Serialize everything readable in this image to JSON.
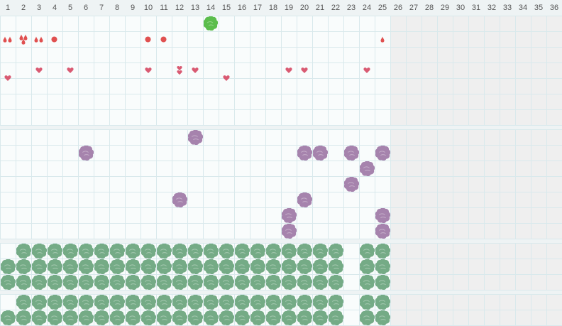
{
  "header": {
    "columns": [
      "1",
      "2",
      "3",
      "4",
      "5",
      "6",
      "7",
      "8",
      "9",
      "10",
      "11",
      "12",
      "13",
      "14",
      "15",
      "16",
      "17",
      "18",
      "19",
      "20",
      "21",
      "22",
      "23",
      "24",
      "25",
      "26",
      "27",
      "28",
      "29",
      "30",
      "31",
      "32",
      "33",
      "34",
      "35",
      "36"
    ]
  },
  "settings": {
    "total_columns": 36,
    "active_columns": 25
  },
  "colors": {
    "grid_line": "#d9e9ec",
    "active_bg": "#f9fcfc",
    "inactive_bg": "#efefef",
    "section_gap": "#e8f0f1",
    "heart": "#d95a72",
    "dot": "#e05050",
    "drop": "#e05050",
    "purple_flower": "#a683ad",
    "green_flower": "#75ab86",
    "bright_green_flower": "#5bbd4c"
  },
  "sections": [
    {
      "name": "symbols",
      "rows": 7,
      "items": [
        {
          "type": "green-flower",
          "row": 0,
          "col": 14
        },
        {
          "type": "drops-pair",
          "row": 1,
          "col": 1
        },
        {
          "type": "drops-cluster",
          "row": 1,
          "col": 2
        },
        {
          "type": "drops-pair",
          "row": 1,
          "col": 3
        },
        {
          "type": "dot",
          "row": 1,
          "col": 4
        },
        {
          "type": "dot",
          "row": 1,
          "col": 10
        },
        {
          "type": "dot",
          "row": 1,
          "col": 11
        },
        {
          "type": "drop",
          "row": 1,
          "col": 25
        },
        {
          "type": "heart",
          "row": 3,
          "col": 1,
          "offset": 0.5
        },
        {
          "type": "heart",
          "row": 3,
          "col": 3
        },
        {
          "type": "heart",
          "row": 3,
          "col": 5
        },
        {
          "type": "heart",
          "row": 3,
          "col": 10
        },
        {
          "type": "heart-pair",
          "row": 3,
          "col": 12
        },
        {
          "type": "heart",
          "row": 3,
          "col": 13
        },
        {
          "type": "heart",
          "row": 3,
          "col": 15,
          "offset": 0.5
        },
        {
          "type": "heart",
          "row": 3,
          "col": 19
        },
        {
          "type": "heart",
          "row": 3,
          "col": 20
        },
        {
          "type": "heart",
          "row": 3,
          "col": 24
        }
      ]
    },
    {
      "name": "purple",
      "rows": 7,
      "items": [
        {
          "type": "purple-flower",
          "row": 0,
          "col": 13
        },
        {
          "type": "purple-flower",
          "row": 1,
          "col": 6
        },
        {
          "type": "purple-flower",
          "row": 1,
          "col": 20
        },
        {
          "type": "purple-flower",
          "row": 1,
          "col": 21
        },
        {
          "type": "purple-flower",
          "row": 1,
          "col": 23
        },
        {
          "type": "purple-flower",
          "row": 1,
          "col": 25
        },
        {
          "type": "purple-flower",
          "row": 2,
          "col": 24
        },
        {
          "type": "purple-flower",
          "row": 3,
          "col": 23
        },
        {
          "type": "purple-flower",
          "row": 4,
          "col": 12
        },
        {
          "type": "purple-flower",
          "row": 4,
          "col": 20
        },
        {
          "type": "purple-flower",
          "row": 5,
          "col": 19
        },
        {
          "type": "purple-flower",
          "row": 5,
          "col": 25
        },
        {
          "type": "purple-flower",
          "row": 6,
          "col": 19
        },
        {
          "type": "purple-flower",
          "row": 6,
          "col": 25
        }
      ]
    },
    {
      "name": "green-a",
      "rows": 3,
      "fill": {
        "type": "green-flower-muted",
        "rows": [
          {
            "from": 2,
            "to": 22,
            "extra": [
              24,
              25
            ]
          },
          {
            "from": 1,
            "to": 22,
            "extra": [
              24,
              25
            ]
          },
          {
            "from": 1,
            "to": 22,
            "extra": [
              24,
              25
            ]
          }
        ]
      }
    },
    {
      "name": "green-b",
      "rows": 2,
      "fill": {
        "type": "green-flower-muted",
        "rows": [
          {
            "from": 2,
            "to": 22,
            "extra": [
              24,
              25
            ]
          },
          {
            "from": 1,
            "to": 22,
            "extra": [
              24,
              25
            ]
          }
        ]
      }
    }
  ]
}
